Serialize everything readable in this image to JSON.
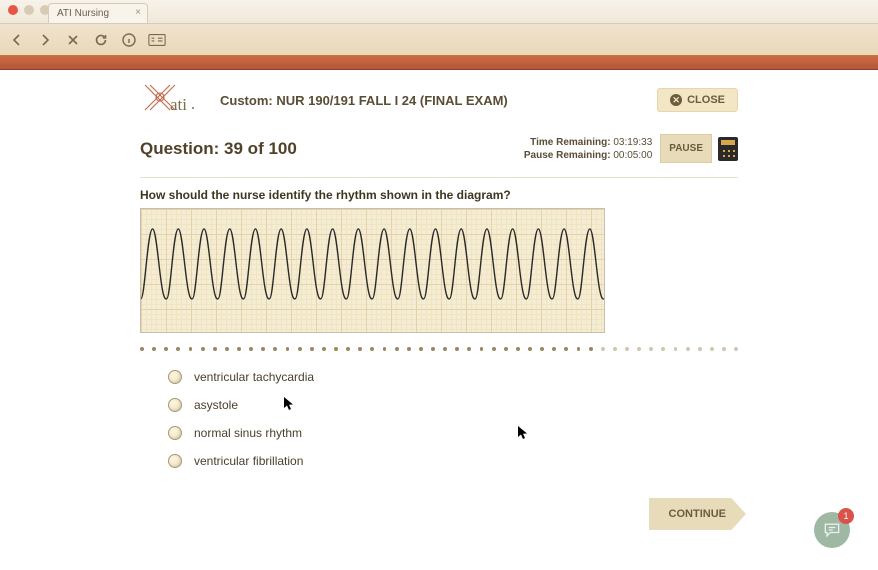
{
  "browser": {
    "tab_title": "ATI Nursing"
  },
  "header": {
    "logo_text": "ati",
    "exam_title": "Custom: NUR 190/191 FALL I 24 (FINAL EXAM)",
    "close_label": "CLOSE"
  },
  "question": {
    "heading": "Question: 39 of 100",
    "time_remaining_label": "Time Remaining:",
    "time_remaining_value": "03:19:33",
    "pause_remaining_label": "Pause Remaining:",
    "pause_remaining_value": "00:05:00",
    "pause_label": "PAUSE",
    "prompt": "How should the nurse identify the rhythm shown in the diagram?",
    "options": [
      "ventricular tachycardia",
      "asystole",
      "normal sinus rhythm",
      "ventricular fibrillation"
    ]
  },
  "footer": {
    "continue_label": "CONTINUE",
    "chat_badge": "1"
  },
  "colors": {
    "accent_orange": "#cc6a44",
    "button_beige": "#e8dbba",
    "text_dark": "#4f4228"
  }
}
